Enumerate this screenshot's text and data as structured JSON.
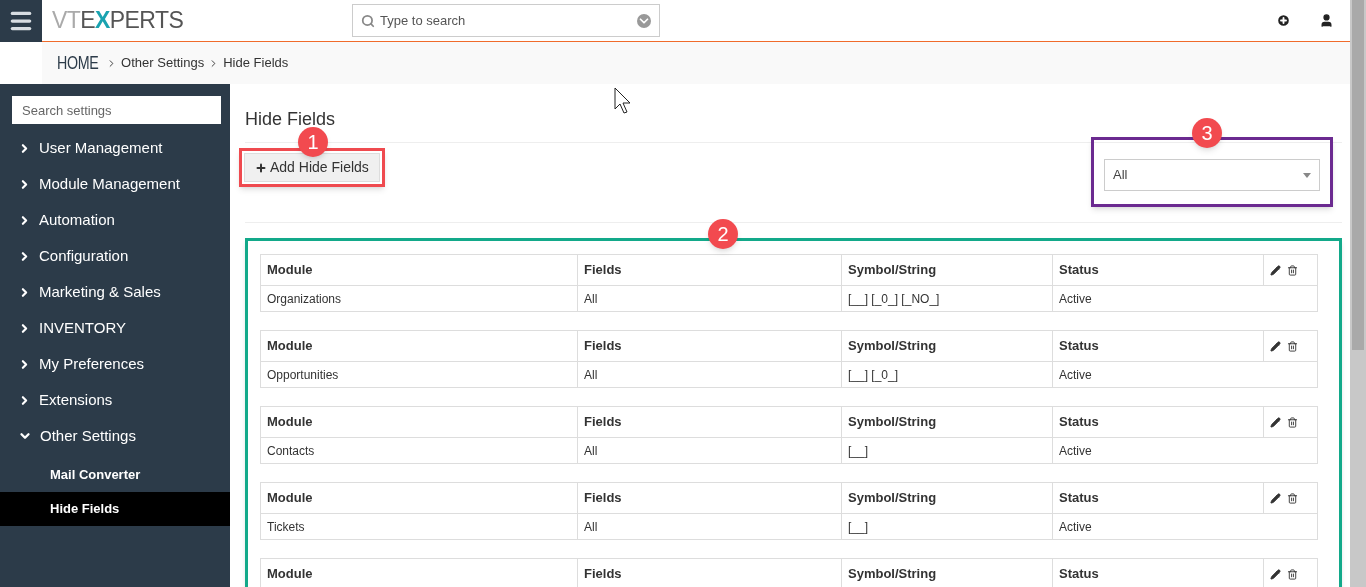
{
  "topbar": {
    "logo": {
      "before": "VTE",
      "mark": "X",
      "after": "PERTS"
    },
    "search": {
      "placeholder": "Type to search"
    }
  },
  "breadcrumb": [
    "HOME",
    "Other Settings",
    "Hide Fields"
  ],
  "sidebar": {
    "search": {
      "placeholder": "Search settings"
    },
    "items": [
      {
        "label": "User Management",
        "expanded": false
      },
      {
        "label": "Module Management",
        "expanded": false
      },
      {
        "label": "Automation",
        "expanded": false
      },
      {
        "label": "Configuration",
        "expanded": false
      },
      {
        "label": "Marketing & Sales",
        "expanded": false
      },
      {
        "label": "INVENTORY",
        "expanded": false
      },
      {
        "label": "My Preferences",
        "expanded": false
      },
      {
        "label": "Extensions",
        "expanded": false
      },
      {
        "label": "Other Settings",
        "expanded": true,
        "children": [
          {
            "label": "Mail Converter",
            "selected": false
          },
          {
            "label": "Hide Fields",
            "selected": true
          }
        ]
      }
    ]
  },
  "page": {
    "title": "Hide Fields",
    "add_button": "Add Hide Fields",
    "filter": {
      "value": "All"
    }
  },
  "tables": [
    {
      "columns": [
        "Module",
        "Fields",
        "Symbol/String",
        "Status"
      ],
      "row": [
        "Organizations",
        "All",
        "[__] [_0_] [_NO_]",
        "Active"
      ]
    },
    {
      "columns": [
        "Module",
        "Fields",
        "Symbol/String",
        "Status"
      ],
      "row": [
        "Opportunities",
        "All",
        "[__] [_0_]",
        "Active"
      ]
    },
    {
      "columns": [
        "Module",
        "Fields",
        "Symbol/String",
        "Status"
      ],
      "row": [
        "Contacts",
        "All",
        "[__]",
        "Active"
      ]
    },
    {
      "columns": [
        "Module",
        "Fields",
        "Symbol/String",
        "Status"
      ],
      "row": [
        "Tickets",
        "All",
        "[__]",
        "Active"
      ]
    },
    {
      "columns": [
        "Module",
        "Fields",
        "Symbol/String",
        "Status"
      ]
    }
  ],
  "annotations": [
    {
      "label": "1",
      "color": "#ef4a4f"
    },
    {
      "label": "2",
      "color": "#13a98a"
    },
    {
      "label": "3",
      "color": "#6b2a90"
    }
  ]
}
